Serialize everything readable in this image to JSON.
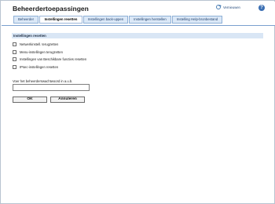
{
  "header": {
    "title": "Beheerdertoepassingen",
    "refresh_label": "Vernieuwen",
    "help_label": "?"
  },
  "tabs": [
    {
      "label": "Beheerder",
      "active": false
    },
    {
      "label": "Instellingen resetten",
      "active": true
    },
    {
      "label": "Instellingen back-uppen",
      "active": false
    },
    {
      "label": "Instellingen herstellen",
      "active": false
    },
    {
      "label": "Instelling Help-bronbestand",
      "active": false
    }
  ],
  "section": {
    "title": "Instellingen resetten",
    "options": [
      {
        "label": "Netwerkinstell. terugzetten",
        "checked": false
      },
      {
        "label": "Menu-instellingen terugzetten",
        "checked": false
      },
      {
        "label": "Instellingen van Beschikbare functies resetten",
        "checked": false
      },
      {
        "label": "IPsec-instellingen resetten",
        "checked": false
      }
    ]
  },
  "password": {
    "label": "Voer het beheerderswachtwoord in a.u.b.",
    "value": "",
    "placeholder": ""
  },
  "buttons": {
    "ok_label": "OK",
    "cancel_label": "Annuleren"
  },
  "colors": {
    "accent": "#3b6fb3",
    "tab_bg": "#dbe8f7",
    "section_bg": "#d9e6f5"
  }
}
